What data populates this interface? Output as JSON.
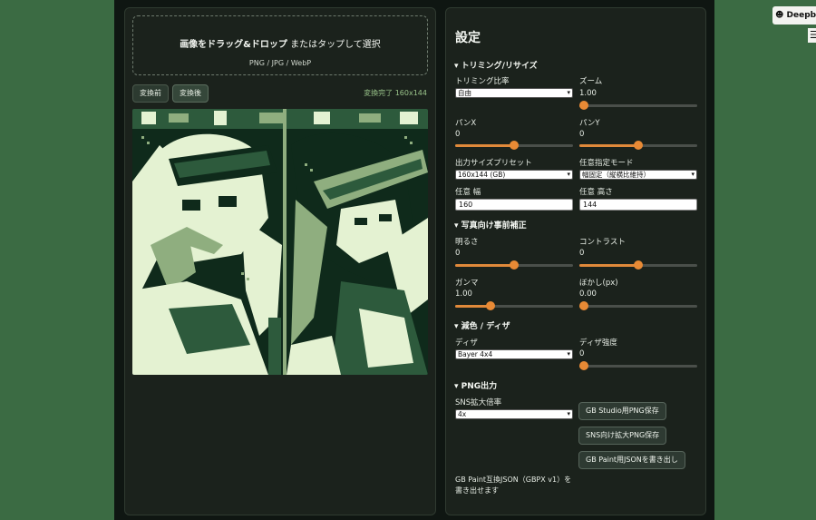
{
  "upload": {
    "main_bold": "画像をドラッグ&ドロップ",
    "main_rest": " またはタップして選択",
    "formats": "PNG / JPG / WebP"
  },
  "view": {
    "before_label": "変換前",
    "after_label": "変換後",
    "status": "変換完了 160x144"
  },
  "palette": [
    "#0f2a1b",
    "#2d5a3c",
    "#8fae7f",
    "#e4f2d2"
  ],
  "settings": {
    "title": "設定",
    "trim": {
      "heading": "▾ トリミング/リサイズ",
      "ratio_label": "トリミング比率",
      "ratio_value": "自由",
      "zoom_label": "ズーム",
      "zoom_value": "1.00",
      "zoom_level": 0.0,
      "panx_label": "パンX",
      "panx_value": "0",
      "panx_level": 0.5,
      "pany_label": "パンY",
      "pany_value": "0",
      "pany_level": 0.5,
      "preset_label": "出力サイズプリセット",
      "preset_value": "160x144 (GB)",
      "mode_label": "任意指定モード",
      "mode_value": "幅固定（縦横比維持）",
      "width_label": "任意 幅",
      "width_value": "160",
      "height_label": "任意 高さ",
      "height_value": "144"
    },
    "photo": {
      "heading": "▾ 写真向け事前補正",
      "brightness_label": "明るさ",
      "brightness_value": "0",
      "brightness_level": 0.5,
      "contrast_label": "コントラスト",
      "contrast_value": "0",
      "contrast_level": 0.5,
      "gamma_label": "ガンマ",
      "gamma_value": "1.00",
      "gamma_level": 0.3,
      "blur_label": "ぼかし(px)",
      "blur_value": "0.00",
      "blur_level": 0.0
    },
    "dither": {
      "heading": "▾ 減色 / ディザ",
      "dither_label": "ディザ",
      "dither_value": "Bayer 4x4",
      "strength_label": "ディザ強度",
      "strength_value": "0",
      "strength_level": 0.0
    },
    "png": {
      "heading": "▾ PNG出力",
      "scale_label": "SNS拡大倍率",
      "scale_value": "4x",
      "gbstudio_button": "GB Studio用PNG保存",
      "sns_button": "SNS向け拡大PNG保存",
      "gbpaint_button": "GB Paint用JSONを書き出し",
      "note": "GB Paint互換JSON（GBPX v1）を書き出せます"
    }
  },
  "topbar": {
    "deepbrain_label": "Deepb",
    "menu_icon": "☰"
  }
}
